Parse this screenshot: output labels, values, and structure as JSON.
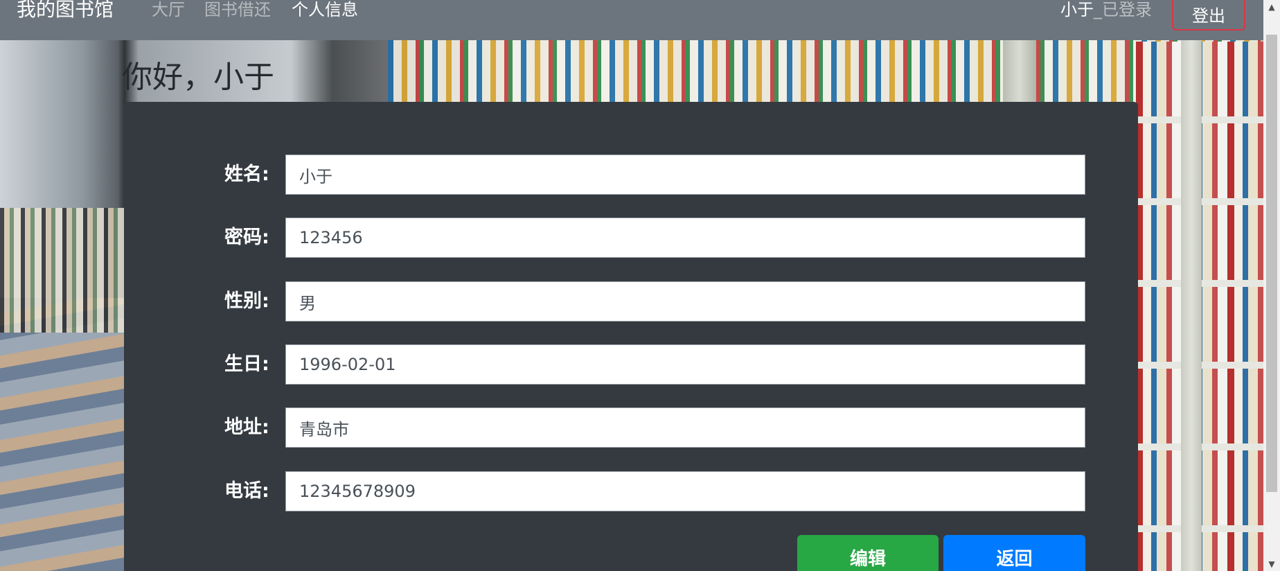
{
  "navbar": {
    "brand": "我的图书馆",
    "links": [
      {
        "label": "大厅"
      },
      {
        "label": "图书借还"
      },
      {
        "label": "个人信息"
      }
    ],
    "user_name": "小于",
    "user_status": "_已登录",
    "logout_label": "登出"
  },
  "greeting": "你好，小于",
  "form": {
    "fields": [
      {
        "label": "姓名:",
        "value": "小于"
      },
      {
        "label": "密码:",
        "value": "123456"
      },
      {
        "label": "性别:",
        "value": "男"
      },
      {
        "label": "生日:",
        "value": "1996-02-01"
      },
      {
        "label": "地址:",
        "value": "青岛市"
      },
      {
        "label": "电话:",
        "value": "12345678909"
      }
    ],
    "edit_label": "编辑",
    "back_label": "返回"
  },
  "colors": {
    "navbar_bg": "#6c757d",
    "card_bg": "#343a40",
    "edit_button": "#28a745",
    "back_button": "#007bff",
    "logout_border": "#dc3545"
  },
  "icons": {
    "scroll_up": "scroll-up-arrow-icon",
    "scroll_down": "scroll-down-arrow-icon"
  }
}
